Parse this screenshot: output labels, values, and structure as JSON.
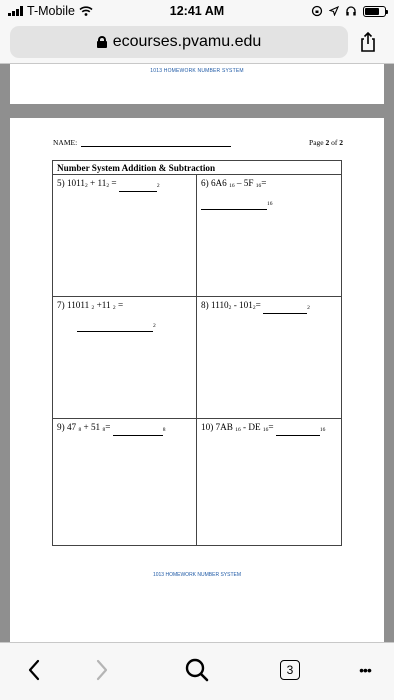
{
  "status": {
    "carrier": "T-Mobile",
    "time": "12:41 AM"
  },
  "browser": {
    "url": "ecourses.pvamu.edu",
    "tab_count": "3",
    "more_label": "•••"
  },
  "document": {
    "running_header": "1013 HOMEWORK NUMBER SYSTEM",
    "running_footer": "1013 HOMEWORK NUMBER SYSTEM",
    "name_label": "NAME:",
    "page_label": "Page",
    "page_num": "2",
    "page_of": "of",
    "page_total": "2",
    "title": "Number System Addition & Subtraction",
    "problems": {
      "p5": {
        "num": "5) 1011",
        "b1": "2",
        "op": " + 11",
        "b2": "2",
        "eq": " =",
        "ans_base": "2"
      },
      "p6": {
        "num": "6) 6A6",
        "b1": "16",
        "op": " – 5F",
        "b2": "16",
        "eq": "=",
        "ans_base": "16"
      },
      "p7": {
        "num": "7) 11011",
        "b1": "2",
        "op": " +11",
        "b2": "2",
        "eq": " =",
        "ans_base": "2"
      },
      "p8": {
        "num": "8) 1110",
        "b1": "2",
        "op": " - 101",
        "b2": "2",
        "eq": "=",
        "ans_base": "2"
      },
      "p9": {
        "num": "9) 47",
        "b1": "8",
        "op": " + 51",
        "b2": "8",
        "eq": "=",
        "ans_base": "8"
      },
      "p10": {
        "num": "10) 7AB",
        "b1": "16",
        "op": " - DE",
        "b2": "16",
        "eq": "=",
        "ans_base": "16"
      }
    }
  }
}
